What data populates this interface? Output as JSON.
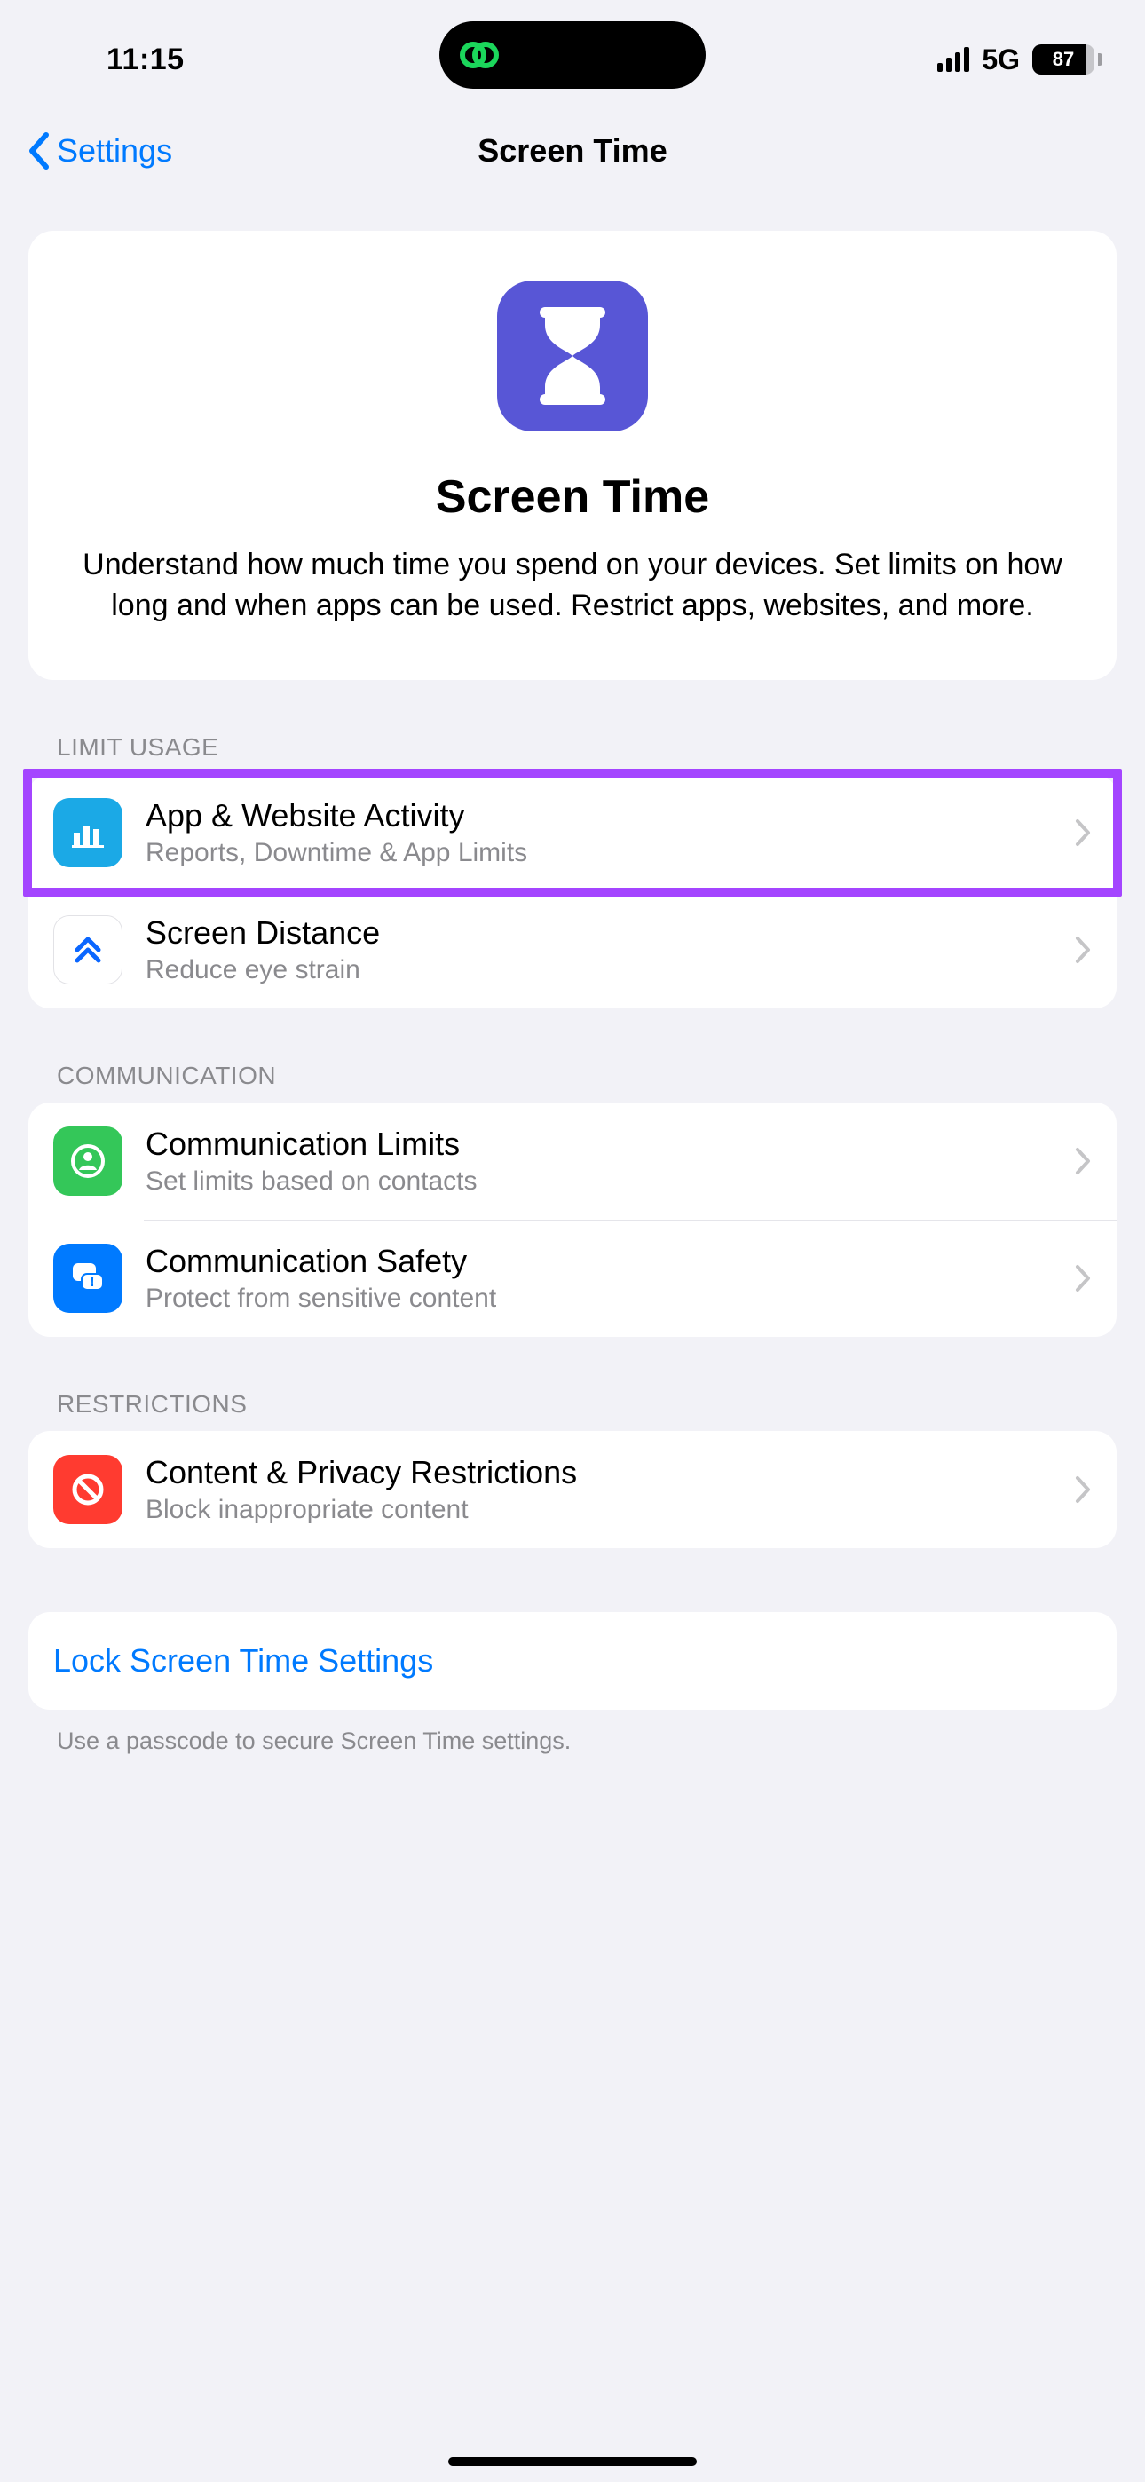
{
  "status": {
    "time": "11:15",
    "network": "5G",
    "battery_pct": "87"
  },
  "nav": {
    "back_label": "Settings",
    "title": "Screen Time"
  },
  "hero": {
    "title": "Screen Time",
    "description": "Understand how much time you spend on your devices. Set limits on how long and when apps can be used. Restrict apps, websites, and more."
  },
  "sections": {
    "limit_usage": {
      "header": "LIMIT USAGE",
      "rows": [
        {
          "title": "App & Website Activity",
          "subtitle": "Reports, Downtime & App Limits"
        },
        {
          "title": "Screen Distance",
          "subtitle": "Reduce eye strain"
        }
      ]
    },
    "communication": {
      "header": "COMMUNICATION",
      "rows": [
        {
          "title": "Communication Limits",
          "subtitle": "Set limits based on contacts"
        },
        {
          "title": "Communication Safety",
          "subtitle": "Protect from sensitive content"
        }
      ]
    },
    "restrictions": {
      "header": "RESTRICTIONS",
      "rows": [
        {
          "title": "Content & Privacy Restrictions",
          "subtitle": "Block inappropriate content"
        }
      ]
    },
    "lock": {
      "row_title": "Lock Screen Time Settings",
      "footer": "Use a passcode to secure Screen Time settings."
    }
  }
}
